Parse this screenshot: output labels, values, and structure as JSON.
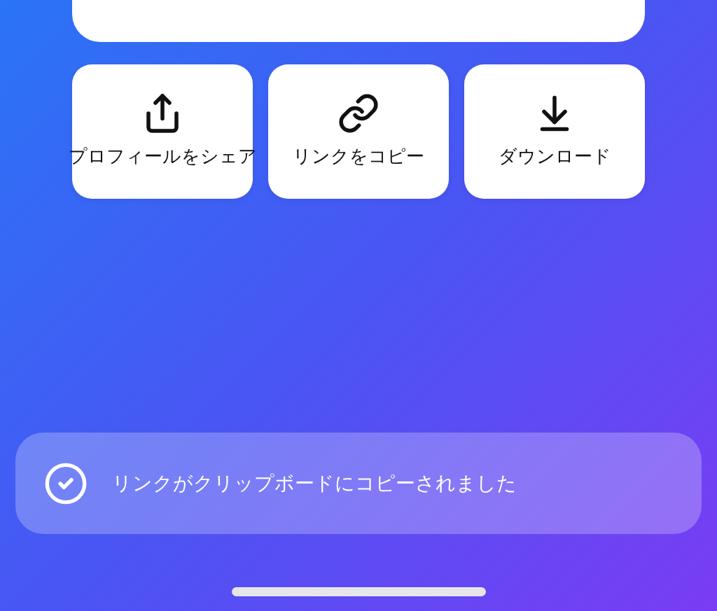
{
  "actions": [
    {
      "kind": "share",
      "label": "プロフィールをシェア"
    },
    {
      "kind": "link",
      "label": "リンクをコピー"
    },
    {
      "kind": "download",
      "label": "ダウンロード"
    }
  ],
  "toast": {
    "message": "リンクがクリップボードにコピーされました"
  }
}
